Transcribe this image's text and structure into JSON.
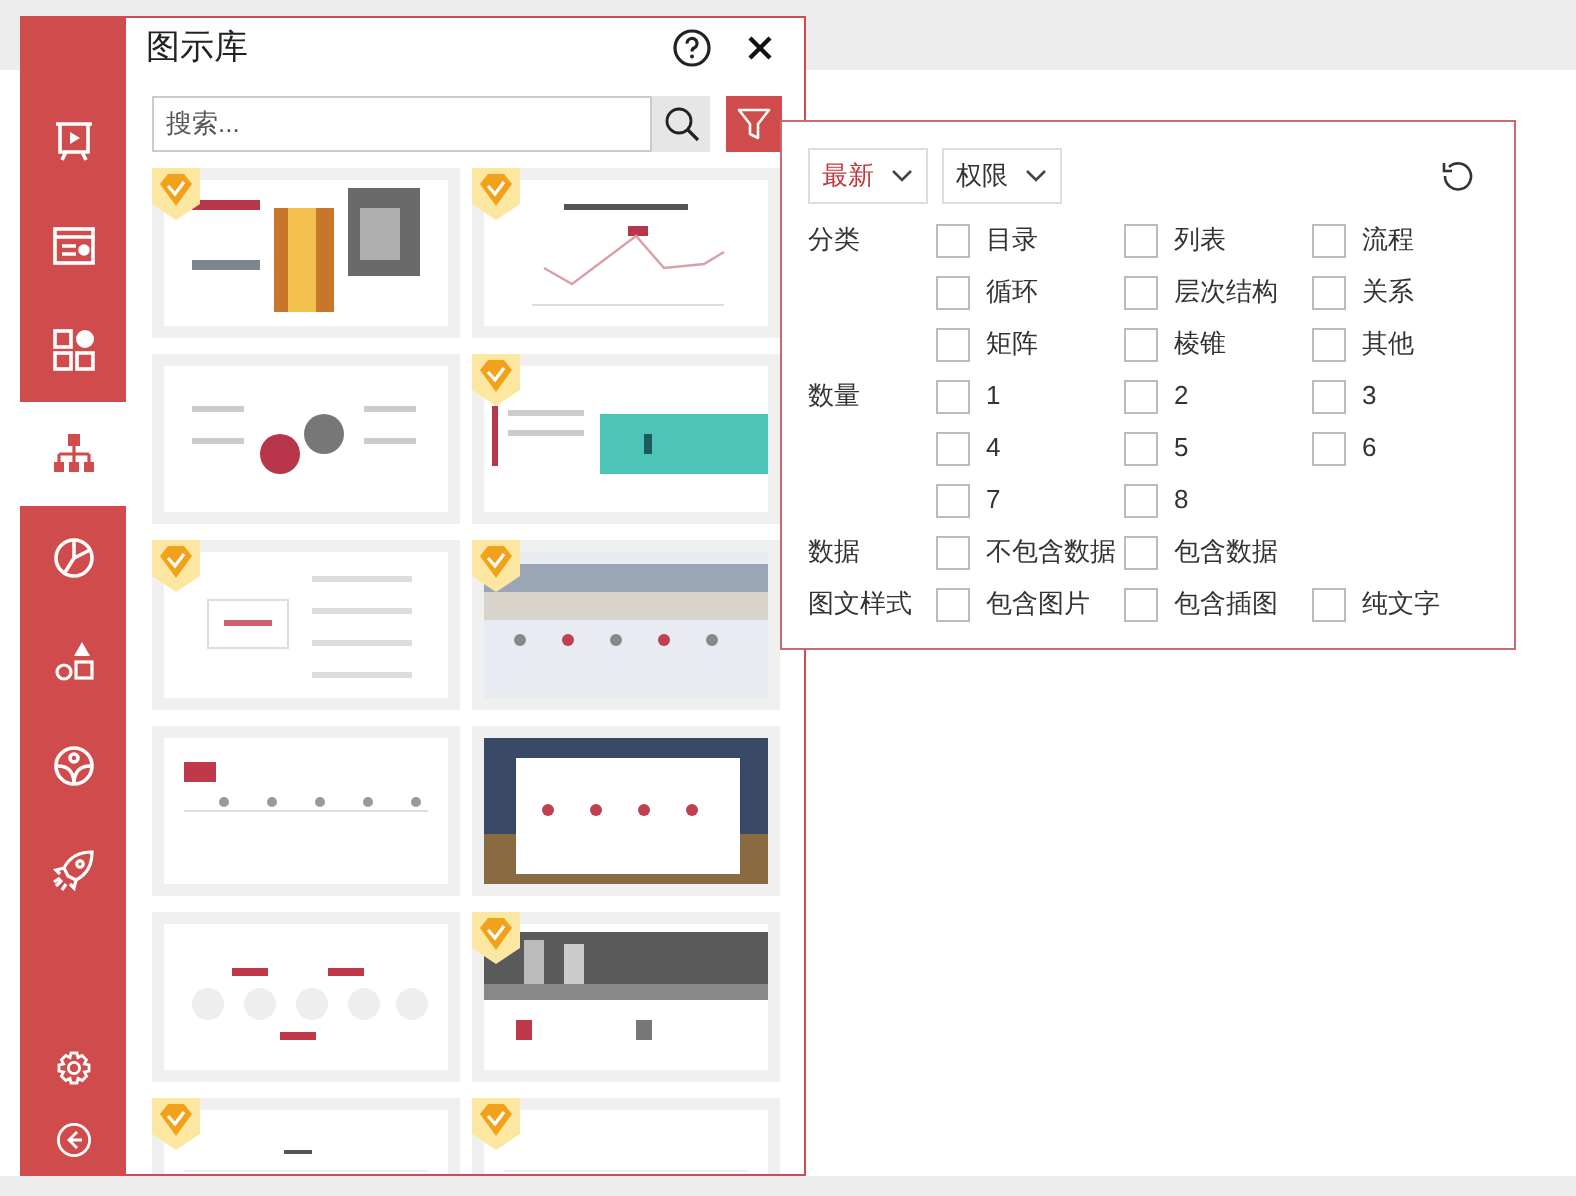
{
  "sidebar": {
    "items": [
      {
        "selected": false
      },
      {
        "selected": false
      },
      {
        "selected": false
      },
      {
        "selected": true
      },
      {
        "selected": false
      },
      {
        "selected": false
      },
      {
        "selected": false
      },
      {
        "selected": false
      }
    ]
  },
  "panel": {
    "title": "图示库",
    "search": {
      "placeholder": "搜索..."
    },
    "thumbnails": [
      {
        "kind": "picture",
        "premium": true
      },
      {
        "kind": "picture",
        "premium": true
      },
      {
        "kind": "picture",
        "premium": false
      },
      {
        "kind": "picture",
        "premium": true
      },
      {
        "kind": "picture",
        "premium": true
      },
      {
        "kind": "picture",
        "premium": true
      },
      {
        "kind": "picture",
        "premium": false
      },
      {
        "kind": "picture",
        "premium": false
      },
      {
        "kind": "picture",
        "premium": false
      },
      {
        "kind": "picture",
        "premium": true
      },
      {
        "kind": "picture",
        "premium": true
      },
      {
        "kind": "picture",
        "premium": true
      }
    ]
  },
  "filter": {
    "sort": "最新",
    "permission": "权限",
    "groups": [
      {
        "label": "分类",
        "options": [
          {
            "label": "目录",
            "checked": false
          },
          {
            "label": "列表",
            "checked": false
          },
          {
            "label": "流程",
            "checked": false
          },
          {
            "label": "循环",
            "checked": false
          },
          {
            "label": "层次结构",
            "checked": false
          },
          {
            "label": "关系",
            "checked": false
          },
          {
            "label": "矩阵",
            "checked": false
          },
          {
            "label": "棱锥",
            "checked": false
          },
          {
            "label": "其他",
            "checked": false
          }
        ]
      },
      {
        "label": "数量",
        "options": [
          {
            "label": "1",
            "checked": false
          },
          {
            "label": "2",
            "checked": false
          },
          {
            "label": "3",
            "checked": false
          },
          {
            "label": "4",
            "checked": false
          },
          {
            "label": "5",
            "checked": false
          },
          {
            "label": "6",
            "checked": false
          },
          {
            "label": "7",
            "checked": false
          },
          {
            "label": "8",
            "checked": false
          }
        ]
      },
      {
        "label": "数据",
        "options": [
          {
            "label": "不包含数据",
            "checked": false
          },
          {
            "label": "包含数据",
            "checked": false
          }
        ]
      },
      {
        "label": "图文样式",
        "options": [
          {
            "label": "包含图片",
            "checked": false
          },
          {
            "label": "包含插图",
            "checked": false
          },
          {
            "label": "纯文字",
            "checked": false
          }
        ]
      }
    ]
  }
}
